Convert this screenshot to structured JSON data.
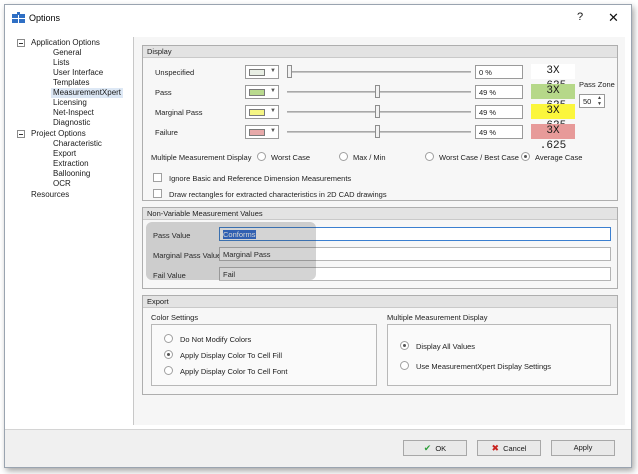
{
  "window": {
    "title": "Options",
    "help_label": "?",
    "close_label": "✕"
  },
  "tree": {
    "application_options": "Application Options",
    "app_children": [
      "General",
      "Lists",
      "User Interface",
      "Templates",
      "MeasurementXpert",
      "Licensing",
      "Net-Inspect",
      "Diagnostic"
    ],
    "project_options": "Project Options",
    "project_children": [
      "Characteristic",
      "Export",
      "Extraction",
      "Ballooning",
      "OCR"
    ],
    "resources": "Resources",
    "selected": "MeasurementXpert"
  },
  "display": {
    "header": "Display",
    "pass_zone_label": "Pass Zone",
    "pass_zone_value": "50",
    "rows": [
      {
        "label": "Unspecified",
        "swatch": "#e8eee4",
        "pct": "0 %",
        "slider": 0.0,
        "sample": "3X .625",
        "sample_bg": "#ffffff"
      },
      {
        "label": "Pass",
        "swatch": "#b9d98e",
        "pct": "49 %",
        "slider": 0.49,
        "sample": "3X .625",
        "sample_bg": "#b6d889"
      },
      {
        "label": "Marginal Pass",
        "swatch": "#f5f584",
        "pct": "49 %",
        "slider": 0.49,
        "sample": "3X .625",
        "sample_bg": "#fbf63c"
      },
      {
        "label": "Failure",
        "swatch": "#e7a9a9",
        "pct": "49 %",
        "slider": 0.49,
        "sample": "3X .625",
        "sample_bg": "#e79a99"
      }
    ],
    "multiple_label": "Multiple Measurement Display",
    "multiple_options": [
      "Worst Case",
      "Max / Min",
      "Worst Case / Best Case",
      "Average Case"
    ],
    "multiple_selected": 3,
    "checkbox_ignore": "Ignore Basic and Reference Dimension Measurements",
    "checkbox_draw": "Draw rectangles for extracted characteristics in 2D CAD drawings"
  },
  "nonvariable": {
    "header": "Non-Variable Measurement Values",
    "pass_label": "Pass Value",
    "pass_value": "Conforms",
    "marginal_label": "Marginal Pass Value",
    "marginal_value": "Marginal Pass",
    "fail_label": "Fail Value",
    "fail_value": "Fail"
  },
  "export": {
    "header": "Export",
    "color_settings_label": "Color Settings",
    "color_options": [
      "Do Not Modify Colors",
      "Apply Display Color To Cell Fill",
      "Apply Display Color To Cell Font"
    ],
    "color_selected": 1,
    "mmd_label": "Multiple Measurement Display",
    "mmd_options": [
      "Display All Values",
      "Use MeasurementXpert Display Settings"
    ],
    "mmd_selected": 0
  },
  "footer": {
    "ok": "OK",
    "cancel": "Cancel",
    "apply": "Apply",
    "ok_color": "#2e9e3a",
    "cancel_color": "#c9231f"
  }
}
